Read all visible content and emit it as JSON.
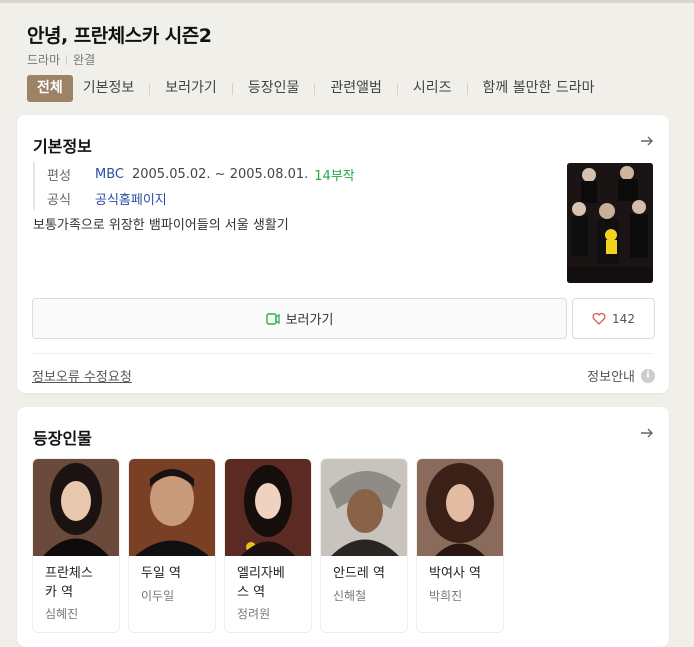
{
  "header": {
    "title": "안녕, 프란체스카 시즌2",
    "genre": "드라마",
    "status": "완결"
  },
  "tabs": [
    {
      "label": "전체",
      "active": true
    },
    {
      "label": "기본정보"
    },
    {
      "label": "보러가기"
    },
    {
      "label": "등장인물"
    },
    {
      "label": "관련앨범"
    },
    {
      "label": "시리즈"
    },
    {
      "label": "함께 볼만한 드라마"
    }
  ],
  "basic_info": {
    "title": "기본정보",
    "broadcast_label": "편성",
    "channel": "MBC",
    "period": "2005.05.02. ~ 2005.08.01.",
    "episodes": "14부작",
    "official_label": "공식",
    "official_link": "공식홈페이지",
    "description": "보통가족으로 위장한 뱀파이어들의 서울 생활기",
    "watch_label": "보러가기",
    "like_count": "142",
    "report_label": "정보오류 수정요청",
    "guide_label": "정보안내"
  },
  "cast_section": {
    "title": "등장인물",
    "members": [
      {
        "role_line1": "프란체스",
        "role_line2": "카 역",
        "actor": "심혜진"
      },
      {
        "role_line1": "두일 역",
        "role_line2": "",
        "actor": "이두일"
      },
      {
        "role_line1": "엘리자베",
        "role_line2": "스 역",
        "actor": "정려원"
      },
      {
        "role_line1": "안드레 역",
        "role_line2": "",
        "actor": "신해철"
      },
      {
        "role_line1": "박여사 역",
        "role_line2": "",
        "actor": "박희진"
      }
    ]
  },
  "colors": {
    "active_tab": "#9c8366",
    "link_blue": "#2b4fa5",
    "episodes_green": "#27a845",
    "background": "#f1efea"
  }
}
